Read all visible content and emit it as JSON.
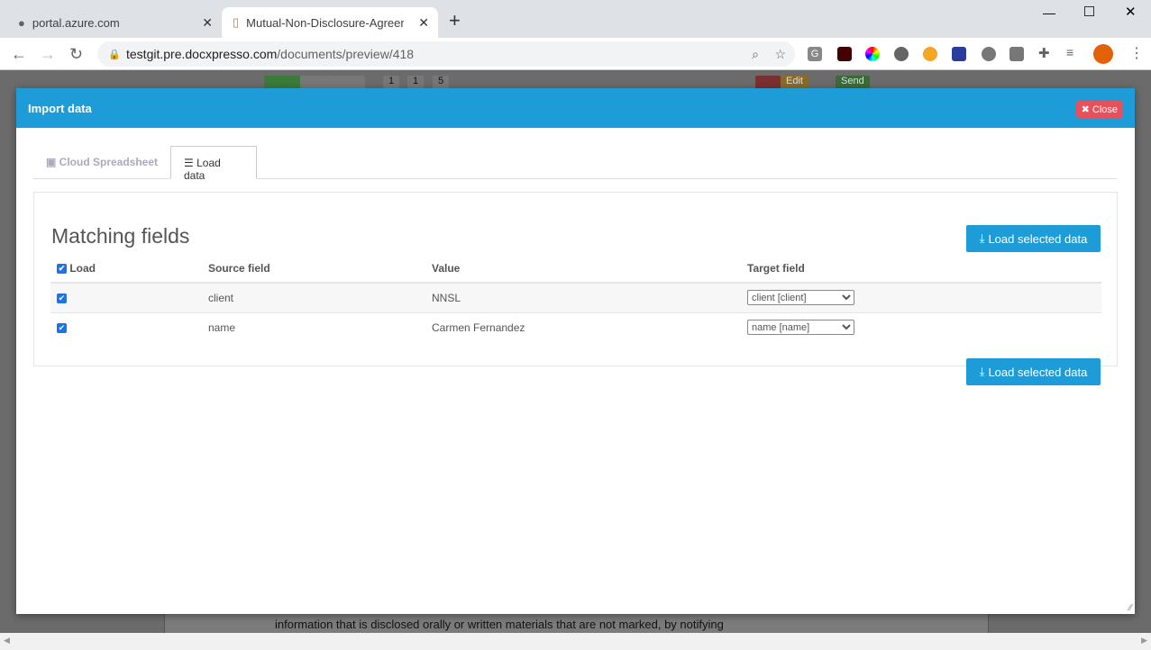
{
  "browser": {
    "tabs": [
      {
        "label": "portal.azure.com",
        "icon": "globe-icon"
      },
      {
        "label": "Mutual-Non-Disclosure-Agreeme",
        "icon": "docxpresso-icon"
      }
    ],
    "url_host": "testgit.pre.docxpresso.com",
    "url_path": "/documents/preview/418",
    "extensions": [
      "G",
      "",
      "",
      "",
      "",
      "",
      "",
      "",
      ""
    ]
  },
  "background": {
    "badges": [
      "1",
      "1",
      "5"
    ],
    "edit_label": "Edit",
    "send_label": "Send",
    "doc_text": "information that is disclosed orally or written materials that are not marked, by notifying"
  },
  "modal": {
    "title": "Import data",
    "close_label": "Close",
    "tabs": [
      {
        "label": "Cloud Spreadsheet",
        "icon": "spreadsheet-icon"
      },
      {
        "label": "Load data",
        "icon": "database-icon",
        "active": true
      }
    ],
    "heading": "Matching fields",
    "load_button": "Load selected data",
    "columns": [
      "Load",
      "Source field",
      "Value",
      "Target field"
    ],
    "rows": [
      {
        "checked": true,
        "source": "client",
        "value": "NNSL",
        "target": "client [client]"
      },
      {
        "checked": true,
        "source": "name",
        "value": "Carmen Fernandez",
        "target": "name [name]"
      }
    ],
    "accent": "#1e9cd7",
    "close_color": "#e8505b"
  }
}
